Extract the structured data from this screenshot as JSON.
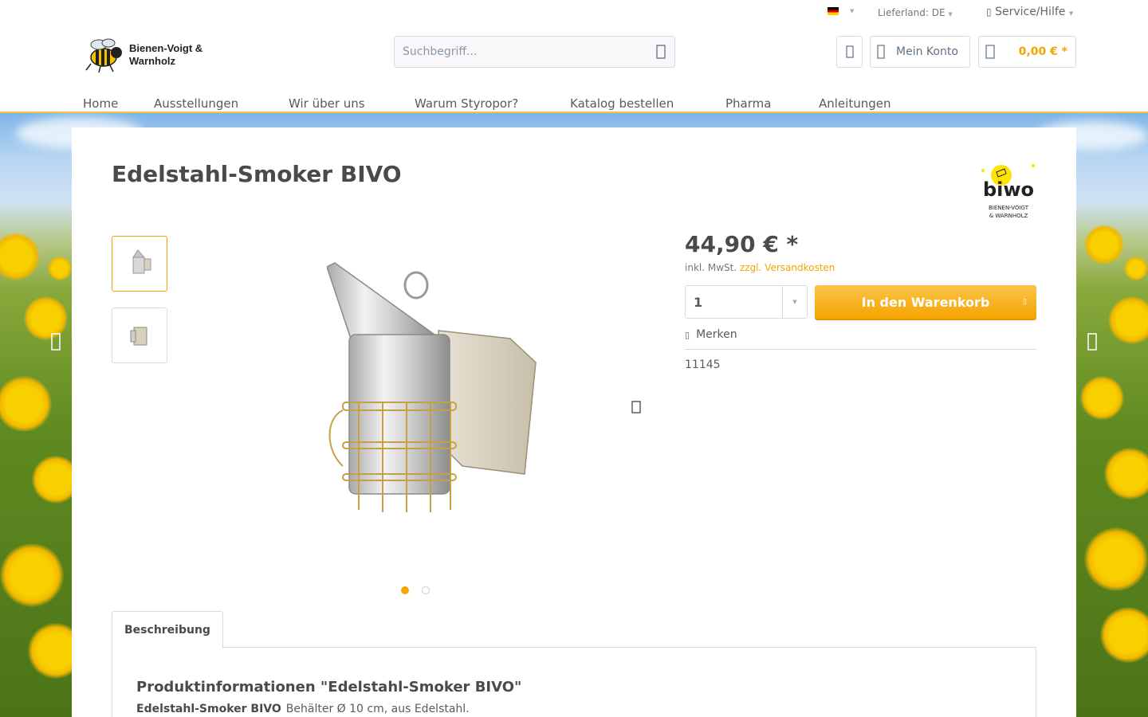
{
  "topbar": {
    "language_flag": "flag-de-icon",
    "delivery_country": "Lieferland: DE",
    "service_label": "Service/Hilfe"
  },
  "header": {
    "logo_line1": "Bienen-Voigt &",
    "logo_line2": "Warnholz",
    "search_placeholder": "Suchbegriff...",
    "account_label": "Mein Konto",
    "cart_amount": "0,00 € *"
  },
  "nav": {
    "items": [
      {
        "label": "Home"
      },
      {
        "label": "Ausstellungen"
      },
      {
        "label": "Wir über uns"
      },
      {
        "label": "Warum Styropor?"
      },
      {
        "label": "Katalog bestellen"
      },
      {
        "label": "Pharma"
      },
      {
        "label": "Anleitungen"
      }
    ]
  },
  "product": {
    "title": "Edelstahl-Smoker BIVO",
    "brand_name": "biwo",
    "brand_sub1": "BIENEN-VOIGT",
    "brand_sub2": "& WARNHOLZ",
    "price": "44,90 € *",
    "tax_note": "inkl. MwSt.",
    "shipping_link": "zzgl. Versandkosten",
    "quantity": "1",
    "add_to_cart": "In den Warenkorb",
    "wishlist": "Merken",
    "sku": "11145",
    "image_count": 2,
    "active_image": 1
  },
  "tabs": {
    "description_tab": "Beschreibung",
    "heading": "Produktinformationen \"Edelstahl-Smoker BIVO\"",
    "lead_bold": "Edelstahl-Smoker BIVO",
    "lead_text": "Behälter Ø 10 cm, aus Edelstahl."
  },
  "colors": {
    "accent": "#f5a400",
    "nav_underline": "#f5c342",
    "text": "#5a5a5a"
  }
}
